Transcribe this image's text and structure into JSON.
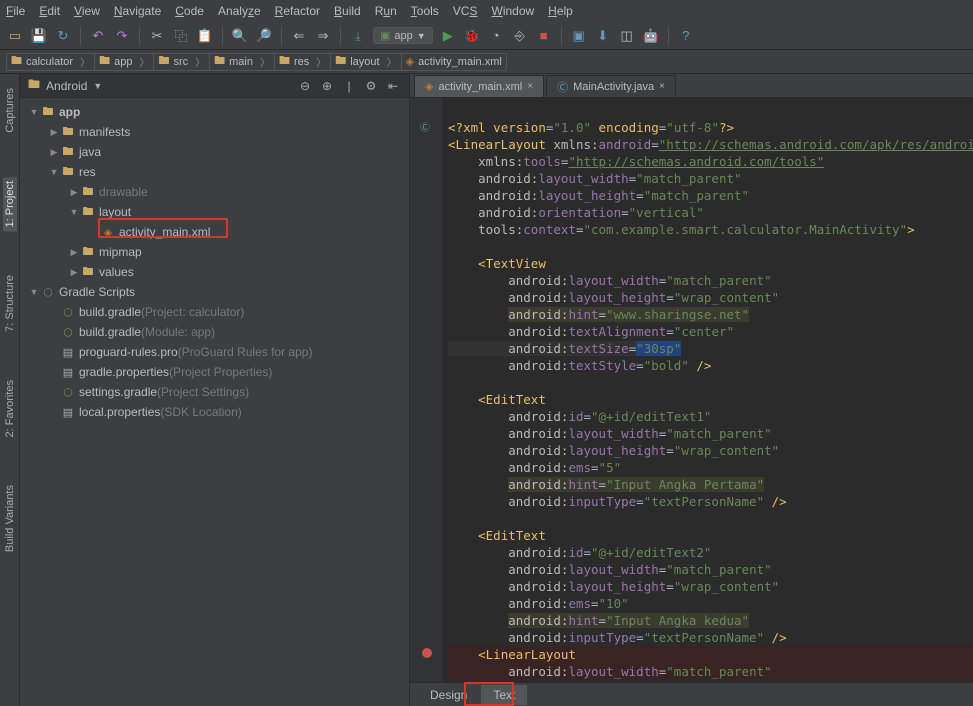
{
  "menu": [
    "File",
    "Edit",
    "View",
    "Navigate",
    "Code",
    "Analyze",
    "Refactor",
    "Build",
    "Run",
    "Tools",
    "VCS",
    "Window",
    "Help"
  ],
  "breadcrumbs": [
    {
      "icon": "folder",
      "label": "calculator"
    },
    {
      "icon": "folder",
      "label": "app"
    },
    {
      "icon": "folder",
      "label": "src"
    },
    {
      "icon": "folder",
      "label": "main"
    },
    {
      "icon": "folder",
      "label": "res"
    },
    {
      "icon": "folder",
      "label": "layout"
    },
    {
      "icon": "xml",
      "label": "activity_main.xml"
    }
  ],
  "run_config": {
    "icon": "▣",
    "label": "app"
  },
  "project_panel": {
    "title": "Android"
  },
  "left_tabs": [
    "Captures",
    "1: Project",
    "7: Structure",
    "2: Favorites",
    "Build Variants"
  ],
  "tree": {
    "app": "app",
    "manifests": "manifests",
    "java": "java",
    "res": "res",
    "drawable": "drawable",
    "layout": "layout",
    "activity_main": "activity_main.xml",
    "mipmap": "mipmap",
    "values": "values",
    "gradle_scripts": "Gradle Scripts",
    "bg1_name": "build.gradle",
    "bg1_hint": "(Project: calculator)",
    "bg2_name": "build.gradle",
    "bg2_hint": "(Module: app)",
    "proguard_name": "proguard-rules.pro",
    "proguard_hint": "(ProGuard Rules for app)",
    "gp_name": "gradle.properties",
    "gp_hint": "(Project Properties)",
    "sg_name": "settings.gradle",
    "sg_hint": "(Project Settings)",
    "lp_name": "local.properties",
    "lp_hint": "(SDK Location)"
  },
  "editor_tabs": [
    {
      "icon": "xml",
      "label": "activity_main.xml",
      "active": true
    },
    {
      "icon": "c",
      "label": "MainActivity.java",
      "active": false
    }
  ],
  "bottom_tabs": {
    "design": "Design",
    "text": "Text"
  },
  "code": {
    "l1_a": "<?",
    "l1_b": "xml version",
    "l1_c": "=",
    "l1_d": "\"1.0\"",
    "l1_e": " encoding",
    "l1_f": "=",
    "l1_g": "\"utf-8\"",
    "l1_h": "?>",
    "l2_a": "<",
    "l2_b": "LinearLayout ",
    "l2_c": "xmlns:",
    "l2_d": "android",
    "l2_e": "=",
    "l2_f": "\"http://schemas.android.com/apk/res/android\"",
    "l3_a": "xmlns:",
    "l3_b": "tools",
    "l3_c": "=",
    "l3_d": "\"http://schemas.android.com/tools\"",
    "l4_a": "android:",
    "l4_b": "layout_width",
    "l4_c": "=",
    "l4_d": "\"match_parent\"",
    "l5_a": "android:",
    "l5_b": "layout_height",
    "l5_c": "=",
    "l5_d": "\"match_parent\"",
    "l6_a": "android:",
    "l6_b": "orientation",
    "l6_c": "=",
    "l6_d": "\"vertical\"",
    "l7_a": "tools:",
    "l7_b": "context",
    "l7_c": "=",
    "l7_d": "\"com.example.smart.calculator.MainActivity\"",
    "l7_e": ">",
    "l9_a": "<",
    "l9_b": "TextView",
    "l10_a": "android:",
    "l10_b": "layout_width",
    "l10_c": "=",
    "l10_d": "\"match_parent\"",
    "l11_a": "android:",
    "l11_b": "layout_height",
    "l11_c": "=",
    "l11_d": "\"wrap_content\"",
    "l12_a": "android:",
    "l12_b": "hint",
    "l12_c": "=",
    "l12_d": "\"www.sharingse.net\"",
    "l13_a": "android:",
    "l13_b": "textAlignment",
    "l13_c": "=",
    "l13_d": "\"center\"",
    "l14_a": "android:",
    "l14_b": "textSize",
    "l14_c": "=",
    "l14_d": "\"30sp\"",
    "l15_a": "android:",
    "l15_b": "textStyle",
    "l15_c": "=",
    "l15_d": "\"bold\"",
    "l15_e": " />",
    "l17_a": "<",
    "l17_b": "EditText",
    "l18_a": "android:",
    "l18_b": "id",
    "l18_c": "=",
    "l18_d": "\"@+id/editText1\"",
    "l19_a": "android:",
    "l19_b": "layout_width",
    "l19_c": "=",
    "l19_d": "\"match_parent\"",
    "l20_a": "android:",
    "l20_b": "layout_height",
    "l20_c": "=",
    "l20_d": "\"wrap_content\"",
    "l21_a": "android:",
    "l21_b": "ems",
    "l21_c": "=",
    "l21_d": "\"5\"",
    "l22_a": "android:",
    "l22_b": "hint",
    "l22_c": "=",
    "l22_d": "\"Input Angka Pertama\"",
    "l23_a": "android:",
    "l23_b": "inputType",
    "l23_c": "=",
    "l23_d": "\"textPersonName\"",
    "l23_e": " />",
    "l25_a": "<",
    "l25_b": "EditText",
    "l26_a": "android:",
    "l26_b": "id",
    "l26_c": "=",
    "l26_d": "\"@+id/editText2\"",
    "l27_a": "android:",
    "l27_b": "layout_width",
    "l27_c": "=",
    "l27_d": "\"match_parent\"",
    "l28_a": "android:",
    "l28_b": "layout_height",
    "l28_c": "=",
    "l28_d": "\"wrap_content\"",
    "l29_a": "android:",
    "l29_b": "ems",
    "l29_c": "=",
    "l29_d": "\"10\"",
    "l30_a": "android:",
    "l30_b": "hint",
    "l30_c": "=",
    "l30_d": "\"Input Angka kedua\"",
    "l31_a": "android:",
    "l31_b": "inputType",
    "l31_c": "=",
    "l31_d": "\"textPersonName\"",
    "l31_e": " />",
    "l32_a": "<",
    "l32_b": "LinearLayout",
    "l33_a": "android:",
    "l33_b": "layout_width",
    "l33_c": "=",
    "l33_d": "\"match_parent\""
  }
}
